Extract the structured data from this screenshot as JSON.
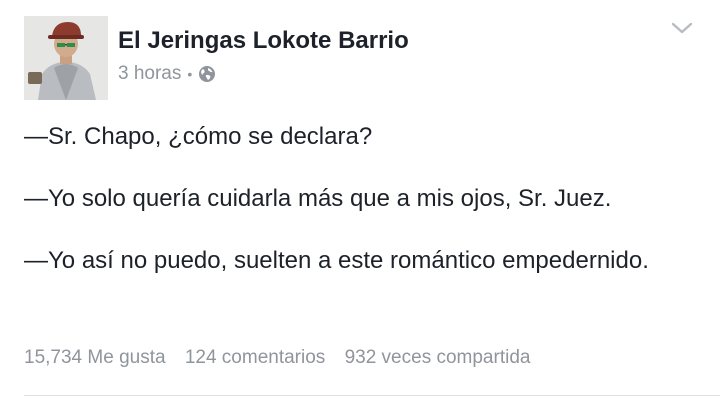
{
  "post": {
    "author": "El Jeringas Lokote Barrio",
    "time": "3 horas",
    "separator": "•",
    "privacy_icon": "globe-icon",
    "menu_icon": "chevron-down-icon",
    "paragraphs": [
      "—Sr. Chapo, ¿cómo se declara?",
      "—Yo solo quería cuidarla más que a mis ojos, Sr. Juez.",
      "—Yo así no puedo, suelten a este romántico empedernido."
    ],
    "stats": {
      "likes": "15,734 Me gusta",
      "comments": "124 comentarios",
      "shares": "932 veces compartida"
    }
  },
  "colors": {
    "text": "#1d2129",
    "meta": "#90949c",
    "divider": "#dddfe2"
  }
}
